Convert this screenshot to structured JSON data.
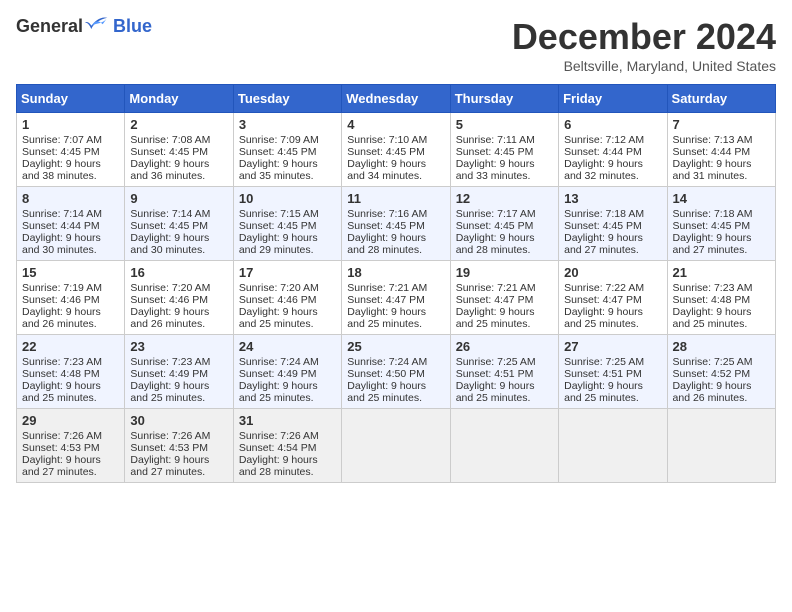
{
  "header": {
    "logo_general": "General",
    "logo_blue": "Blue",
    "month_title": "December 2024",
    "location": "Beltsville, Maryland, United States"
  },
  "days_of_week": [
    "Sunday",
    "Monday",
    "Tuesday",
    "Wednesday",
    "Thursday",
    "Friday",
    "Saturday"
  ],
  "weeks": [
    [
      {
        "day": "1",
        "sunrise": "Sunrise: 7:07 AM",
        "sunset": "Sunset: 4:45 PM",
        "daylight": "Daylight: 9 hours and 38 minutes."
      },
      {
        "day": "2",
        "sunrise": "Sunrise: 7:08 AM",
        "sunset": "Sunset: 4:45 PM",
        "daylight": "Daylight: 9 hours and 36 minutes."
      },
      {
        "day": "3",
        "sunrise": "Sunrise: 7:09 AM",
        "sunset": "Sunset: 4:45 PM",
        "daylight": "Daylight: 9 hours and 35 minutes."
      },
      {
        "day": "4",
        "sunrise": "Sunrise: 7:10 AM",
        "sunset": "Sunset: 4:45 PM",
        "daylight": "Daylight: 9 hours and 34 minutes."
      },
      {
        "day": "5",
        "sunrise": "Sunrise: 7:11 AM",
        "sunset": "Sunset: 4:45 PM",
        "daylight": "Daylight: 9 hours and 33 minutes."
      },
      {
        "day": "6",
        "sunrise": "Sunrise: 7:12 AM",
        "sunset": "Sunset: 4:44 PM",
        "daylight": "Daylight: 9 hours and 32 minutes."
      },
      {
        "day": "7",
        "sunrise": "Sunrise: 7:13 AM",
        "sunset": "Sunset: 4:44 PM",
        "daylight": "Daylight: 9 hours and 31 minutes."
      }
    ],
    [
      {
        "day": "8",
        "sunrise": "Sunrise: 7:14 AM",
        "sunset": "Sunset: 4:44 PM",
        "daylight": "Daylight: 9 hours and 30 minutes."
      },
      {
        "day": "9",
        "sunrise": "Sunrise: 7:14 AM",
        "sunset": "Sunset: 4:45 PM",
        "daylight": "Daylight: 9 hours and 30 minutes."
      },
      {
        "day": "10",
        "sunrise": "Sunrise: 7:15 AM",
        "sunset": "Sunset: 4:45 PM",
        "daylight": "Daylight: 9 hours and 29 minutes."
      },
      {
        "day": "11",
        "sunrise": "Sunrise: 7:16 AM",
        "sunset": "Sunset: 4:45 PM",
        "daylight": "Daylight: 9 hours and 28 minutes."
      },
      {
        "day": "12",
        "sunrise": "Sunrise: 7:17 AM",
        "sunset": "Sunset: 4:45 PM",
        "daylight": "Daylight: 9 hours and 28 minutes."
      },
      {
        "day": "13",
        "sunrise": "Sunrise: 7:18 AM",
        "sunset": "Sunset: 4:45 PM",
        "daylight": "Daylight: 9 hours and 27 minutes."
      },
      {
        "day": "14",
        "sunrise": "Sunrise: 7:18 AM",
        "sunset": "Sunset: 4:45 PM",
        "daylight": "Daylight: 9 hours and 27 minutes."
      }
    ],
    [
      {
        "day": "15",
        "sunrise": "Sunrise: 7:19 AM",
        "sunset": "Sunset: 4:46 PM",
        "daylight": "Daylight: 9 hours and 26 minutes."
      },
      {
        "day": "16",
        "sunrise": "Sunrise: 7:20 AM",
        "sunset": "Sunset: 4:46 PM",
        "daylight": "Daylight: 9 hours and 26 minutes."
      },
      {
        "day": "17",
        "sunrise": "Sunrise: 7:20 AM",
        "sunset": "Sunset: 4:46 PM",
        "daylight": "Daylight: 9 hours and 25 minutes."
      },
      {
        "day": "18",
        "sunrise": "Sunrise: 7:21 AM",
        "sunset": "Sunset: 4:47 PM",
        "daylight": "Daylight: 9 hours and 25 minutes."
      },
      {
        "day": "19",
        "sunrise": "Sunrise: 7:21 AM",
        "sunset": "Sunset: 4:47 PM",
        "daylight": "Daylight: 9 hours and 25 minutes."
      },
      {
        "day": "20",
        "sunrise": "Sunrise: 7:22 AM",
        "sunset": "Sunset: 4:47 PM",
        "daylight": "Daylight: 9 hours and 25 minutes."
      },
      {
        "day": "21",
        "sunrise": "Sunrise: 7:23 AM",
        "sunset": "Sunset: 4:48 PM",
        "daylight": "Daylight: 9 hours and 25 minutes."
      }
    ],
    [
      {
        "day": "22",
        "sunrise": "Sunrise: 7:23 AM",
        "sunset": "Sunset: 4:48 PM",
        "daylight": "Daylight: 9 hours and 25 minutes."
      },
      {
        "day": "23",
        "sunrise": "Sunrise: 7:23 AM",
        "sunset": "Sunset: 4:49 PM",
        "daylight": "Daylight: 9 hours and 25 minutes."
      },
      {
        "day": "24",
        "sunrise": "Sunrise: 7:24 AM",
        "sunset": "Sunset: 4:49 PM",
        "daylight": "Daylight: 9 hours and 25 minutes."
      },
      {
        "day": "25",
        "sunrise": "Sunrise: 7:24 AM",
        "sunset": "Sunset: 4:50 PM",
        "daylight": "Daylight: 9 hours and 25 minutes."
      },
      {
        "day": "26",
        "sunrise": "Sunrise: 7:25 AM",
        "sunset": "Sunset: 4:51 PM",
        "daylight": "Daylight: 9 hours and 25 minutes."
      },
      {
        "day": "27",
        "sunrise": "Sunrise: 7:25 AM",
        "sunset": "Sunset: 4:51 PM",
        "daylight": "Daylight: 9 hours and 25 minutes."
      },
      {
        "day": "28",
        "sunrise": "Sunrise: 7:25 AM",
        "sunset": "Sunset: 4:52 PM",
        "daylight": "Daylight: 9 hours and 26 minutes."
      }
    ],
    [
      {
        "day": "29",
        "sunrise": "Sunrise: 7:26 AM",
        "sunset": "Sunset: 4:53 PM",
        "daylight": "Daylight: 9 hours and 27 minutes."
      },
      {
        "day": "30",
        "sunrise": "Sunrise: 7:26 AM",
        "sunset": "Sunset: 4:53 PM",
        "daylight": "Daylight: 9 hours and 27 minutes."
      },
      {
        "day": "31",
        "sunrise": "Sunrise: 7:26 AM",
        "sunset": "Sunset: 4:54 PM",
        "daylight": "Daylight: 9 hours and 28 minutes."
      },
      null,
      null,
      null,
      null
    ]
  ]
}
